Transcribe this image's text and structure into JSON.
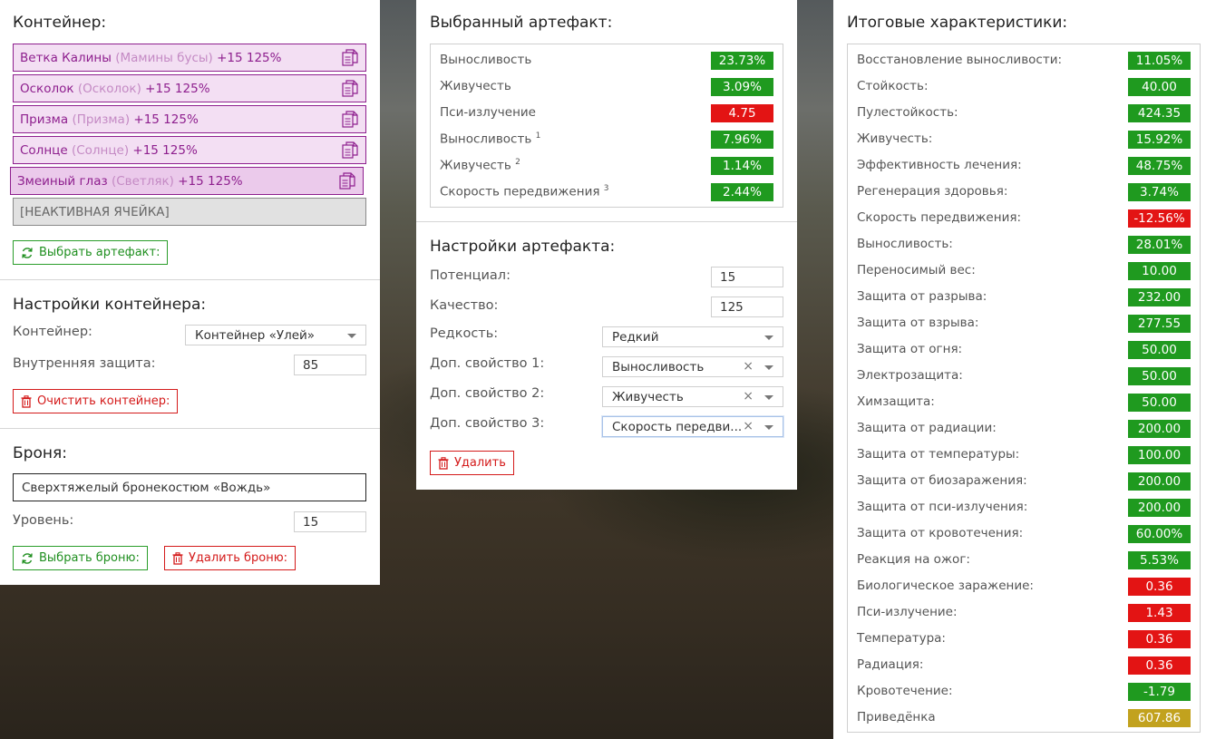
{
  "container_panel": {
    "title": "Контейнер:",
    "slots": [
      {
        "name": "Ветка Калины",
        "sub": "(Мамины бусы)",
        "bonus": "+15 125%"
      },
      {
        "name": "Осколок",
        "sub": "(Осколок)",
        "bonus": "+15 125%"
      },
      {
        "name": "Призма",
        "sub": "(Призма)",
        "bonus": "+15 125%"
      },
      {
        "name": "Солнце",
        "sub": "(Солнце)",
        "bonus": "+15 125%"
      },
      {
        "name": "Змеиный глаз",
        "sub": "(Светляк)",
        "bonus": "+15 125%"
      }
    ],
    "inactive_slot": "[НЕАКТИВНАЯ ЯЧЕЙКА]",
    "select_artifact_button": "Выбрать артефакт:"
  },
  "container_settings": {
    "title": "Настройки контейнера:",
    "container_label": "Контейнер:",
    "container_value": "Контейнер «Улей»",
    "protection_label": "Внутренняя защита:",
    "protection_value": "85",
    "clear_button": "Очистить контейнер:"
  },
  "armor": {
    "title": "Броня:",
    "armor_name": "Сверхтяжелый бронекостюм «Вождь»",
    "level_label": "Уровень:",
    "level_value": "15",
    "select_button": "Выбрать броню:",
    "delete_button": "Удалить броню:"
  },
  "selected_artifact": {
    "title": "Выбранный артефакт:",
    "stats": [
      {
        "name": "Выносливость",
        "sup": "",
        "value": "23.73%",
        "kind": "pos"
      },
      {
        "name": "Живучесть",
        "sup": "",
        "value": "3.09%",
        "kind": "pos"
      },
      {
        "name": "Пси-излучение",
        "sup": "",
        "value": "4.75",
        "kind": "neg"
      },
      {
        "name": "Выносливость",
        "sup": "1",
        "value": "7.96%",
        "kind": "pos"
      },
      {
        "name": "Живучесть",
        "sup": "2",
        "value": "1.14%",
        "kind": "pos"
      },
      {
        "name": "Скорость передвижения",
        "sup": "3",
        "value": "2.44%",
        "kind": "pos"
      }
    ]
  },
  "artifact_settings": {
    "title": "Настройки артефакта:",
    "potential_label": "Потенциал:",
    "potential_value": "15",
    "quality_label": "Качество:",
    "quality_value": "125",
    "rarity_label": "Редкость:",
    "rarity_value": "Редкий",
    "prop1_label": "Доп. свойство 1:",
    "prop1_value": "Выносливость",
    "prop2_label": "Доп. свойство 2:",
    "prop2_value": "Живучесть",
    "prop3_label": "Доп. свойство 3:",
    "prop3_value": "Скорость передви...",
    "clear_glyph": "×",
    "delete_button": "Удалить"
  },
  "totals": {
    "title": "Итоговые характеристики:",
    "stats": [
      {
        "name": "Восстановление выносливости:",
        "value": "11.05%",
        "kind": "pos"
      },
      {
        "name": "Стойкость:",
        "value": "40.00",
        "kind": "pos"
      },
      {
        "name": "Пулестойкость:",
        "value": "424.35",
        "kind": "pos"
      },
      {
        "name": "Живучесть:",
        "value": "15.92%",
        "kind": "pos"
      },
      {
        "name": "Эффективность лечения:",
        "value": "48.75%",
        "kind": "pos"
      },
      {
        "name": "Регенерация здоровья:",
        "value": "3.74%",
        "kind": "pos"
      },
      {
        "name": "Скорость передвижения:",
        "value": "-12.56%",
        "kind": "neg"
      },
      {
        "name": "Выносливость:",
        "value": "28.01%",
        "kind": "pos"
      },
      {
        "name": "Переносимый вес:",
        "value": "10.00",
        "kind": "pos"
      },
      {
        "name": "Защита от разрыва:",
        "value": "232.00",
        "kind": "pos"
      },
      {
        "name": "Защита от взрыва:",
        "value": "277.55",
        "kind": "pos"
      },
      {
        "name": "Защита от огня:",
        "value": "50.00",
        "kind": "pos"
      },
      {
        "name": "Электрозащита:",
        "value": "50.00",
        "kind": "pos"
      },
      {
        "name": "Химзащита:",
        "value": "50.00",
        "kind": "pos"
      },
      {
        "name": "Защита от радиации:",
        "value": "200.00",
        "kind": "pos"
      },
      {
        "name": "Защита от температуры:",
        "value": "100.00",
        "kind": "pos"
      },
      {
        "name": "Защита от биозаражения:",
        "value": "200.00",
        "kind": "pos"
      },
      {
        "name": "Защита от пси-излучения:",
        "value": "200.00",
        "kind": "pos"
      },
      {
        "name": "Защита от кровотечения:",
        "value": "60.00%",
        "kind": "pos"
      },
      {
        "name": "Реакция на ожог:",
        "value": "5.53%",
        "kind": "pos"
      },
      {
        "name": "Биологическое заражение:",
        "value": "0.36",
        "kind": "neg"
      },
      {
        "name": "Пси-излучение:",
        "value": "1.43",
        "kind": "neg"
      },
      {
        "name": "Температура:",
        "value": "0.36",
        "kind": "neg"
      },
      {
        "name": "Радиация:",
        "value": "0.36",
        "kind": "neg"
      },
      {
        "name": "Кровотечение:",
        "value": "-1.79",
        "kind": "pos"
      },
      {
        "name": "Приведёнка",
        "value": "607.86",
        "kind": "gold"
      }
    ]
  },
  "colors": {
    "accent_purple": "#8e1f8e",
    "positive": "#1f9a1f",
    "negative": "#e31414",
    "gold": "#c2a21e",
    "button_green": "#2a9d2a",
    "button_red": "#d41a1a"
  }
}
